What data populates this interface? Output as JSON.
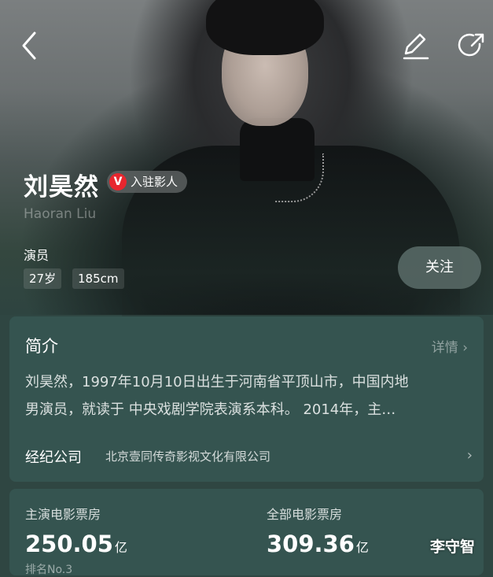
{
  "header": {
    "back_icon": "back-arrow-icon",
    "edit_icon": "edit-pencil-icon",
    "share_icon": "share-icon"
  },
  "profile": {
    "name": "刘昊然",
    "badge_mark": "V",
    "badge_label": "入驻影人",
    "english_name": "Haoran Liu",
    "role": "演员",
    "age": "27岁",
    "height": "185cm",
    "follow_label": "关注"
  },
  "intro": {
    "title": "简介",
    "detail_label": "详情",
    "line1": "刘昊然，1997年10月10日出生于河南省平顶山市，中国内地",
    "line2": "男演员，就读于 中央戏剧学院表演系本科。 2014年，主…",
    "agency_label": "经纪公司",
    "agency_name": "北京壹同传奇影视文化有限公司"
  },
  "box_office": {
    "lead_label": "主演电影票房",
    "lead_value": "250.05",
    "lead_unit": "亿",
    "lead_sub": "排名No.3",
    "total_label": "全部电影票房",
    "total_value": "309.36",
    "total_unit": "亿"
  },
  "watermark": "李守智",
  "colors": {
    "card_bg": "#355450",
    "badge_red": "#e8262e",
    "page_bg": "#2f4642"
  }
}
